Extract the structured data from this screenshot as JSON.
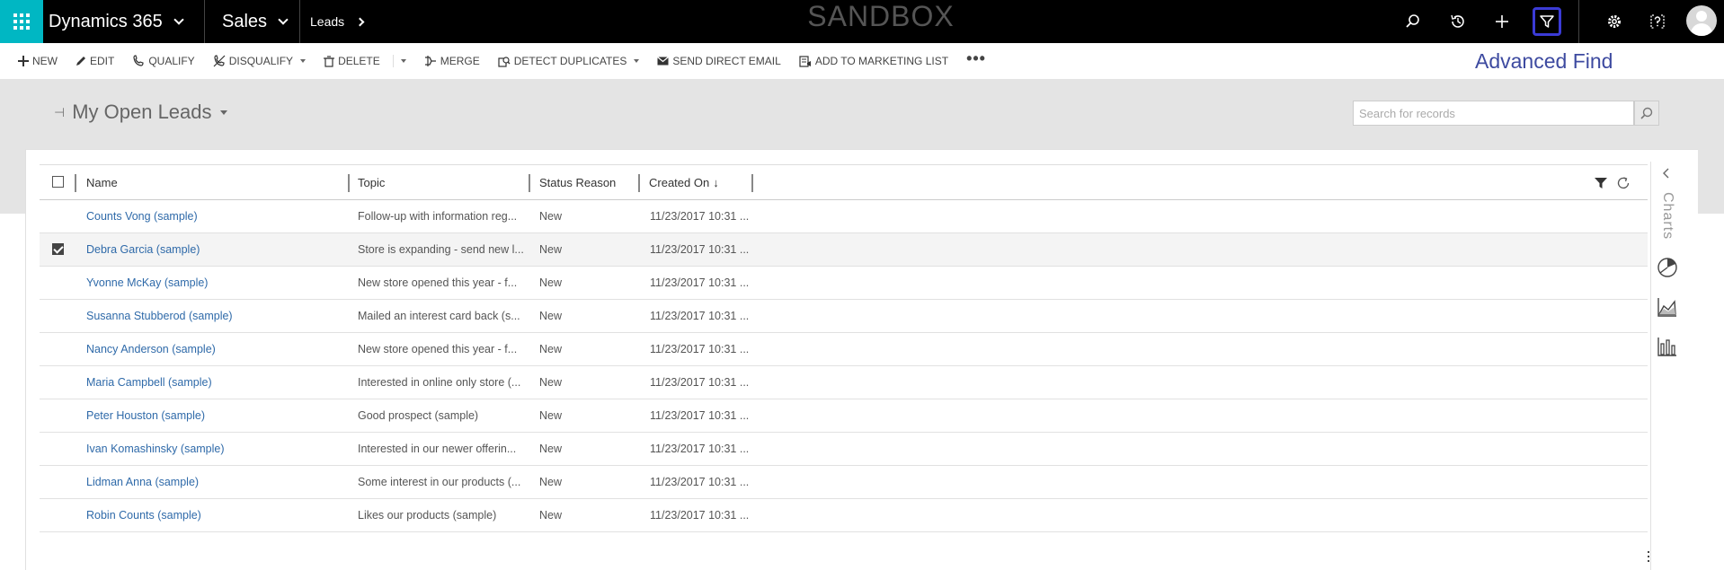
{
  "topnav": {
    "app_title": "Dynamics 365",
    "module": "Sales",
    "breadcrumb": "Leads",
    "environment_label": "SANDBOX"
  },
  "commands": {
    "new": "NEW",
    "edit": "EDIT",
    "qualify": "QUALIFY",
    "disqualify": "DISQUALIFY",
    "delete": "DELETE",
    "merge": "MERGE",
    "detect_duplicates": "DETECT DUPLICATES",
    "send_direct_email": "SEND DIRECT EMAIL",
    "add_to_marketing_list": "ADD TO MARKETING LIST",
    "more": "•••"
  },
  "annotation": {
    "advanced_find": "Advanced Find"
  },
  "view": {
    "title": "My Open Leads",
    "pin_glyph": "⊣"
  },
  "search": {
    "placeholder": "Search for records"
  },
  "grid": {
    "columns": {
      "name": "Name",
      "topic": "Topic",
      "status_reason": "Status Reason",
      "created_on": "Created On"
    },
    "sort_indicator": "↓",
    "rows": [
      {
        "name": "Counts Vong (sample)",
        "topic": "Follow-up with information reg...",
        "status": "New",
        "created": "11/23/2017 10:31 ...",
        "selected": false
      },
      {
        "name": "Debra Garcia (sample)",
        "topic": "Store is expanding - send new l...",
        "status": "New",
        "created": "11/23/2017 10:31 ...",
        "selected": true
      },
      {
        "name": "Yvonne McKay (sample)",
        "topic": "New store opened this year - f...",
        "status": "New",
        "created": "11/23/2017 10:31 ...",
        "selected": false
      },
      {
        "name": "Susanna Stubberod (sample)",
        "topic": "Mailed an interest card back (s...",
        "status": "New",
        "created": "11/23/2017 10:31 ...",
        "selected": false
      },
      {
        "name": "Nancy Anderson (sample)",
        "topic": "New store opened this year - f...",
        "status": "New",
        "created": "11/23/2017 10:31 ...",
        "selected": false
      },
      {
        "name": "Maria Campbell (sample)",
        "topic": "Interested in online only store (...",
        "status": "New",
        "created": "11/23/2017 10:31 ...",
        "selected": false
      },
      {
        "name": "Peter Houston (sample)",
        "topic": "Good prospect (sample)",
        "status": "New",
        "created": "11/23/2017 10:31 ...",
        "selected": false
      },
      {
        "name": "Ivan Komashinsky (sample)",
        "topic": "Interested in our newer offerin...",
        "status": "New",
        "created": "11/23/2017 10:31 ...",
        "selected": false
      },
      {
        "name": "Lidman Anna (sample)",
        "topic": "Some interest in our products (...",
        "status": "New",
        "created": "11/23/2017 10:31 ...",
        "selected": false
      },
      {
        "name": "Robin Counts (sample)",
        "topic": "Likes our products (sample)",
        "status": "New",
        "created": "11/23/2017 10:31 ...",
        "selected": false
      }
    ]
  },
  "charts_pane": {
    "label": "Charts",
    "icons": [
      "pie-chart-icon",
      "area-chart-icon",
      "bar-chart-icon"
    ]
  },
  "colors": {
    "waffle": "#00b7c3",
    "topbar": "#000000",
    "highlight": "#3b3bd6",
    "link": "#2f6aa9",
    "annotation": "#3d4aa0",
    "band": "#e4e4e4"
  }
}
